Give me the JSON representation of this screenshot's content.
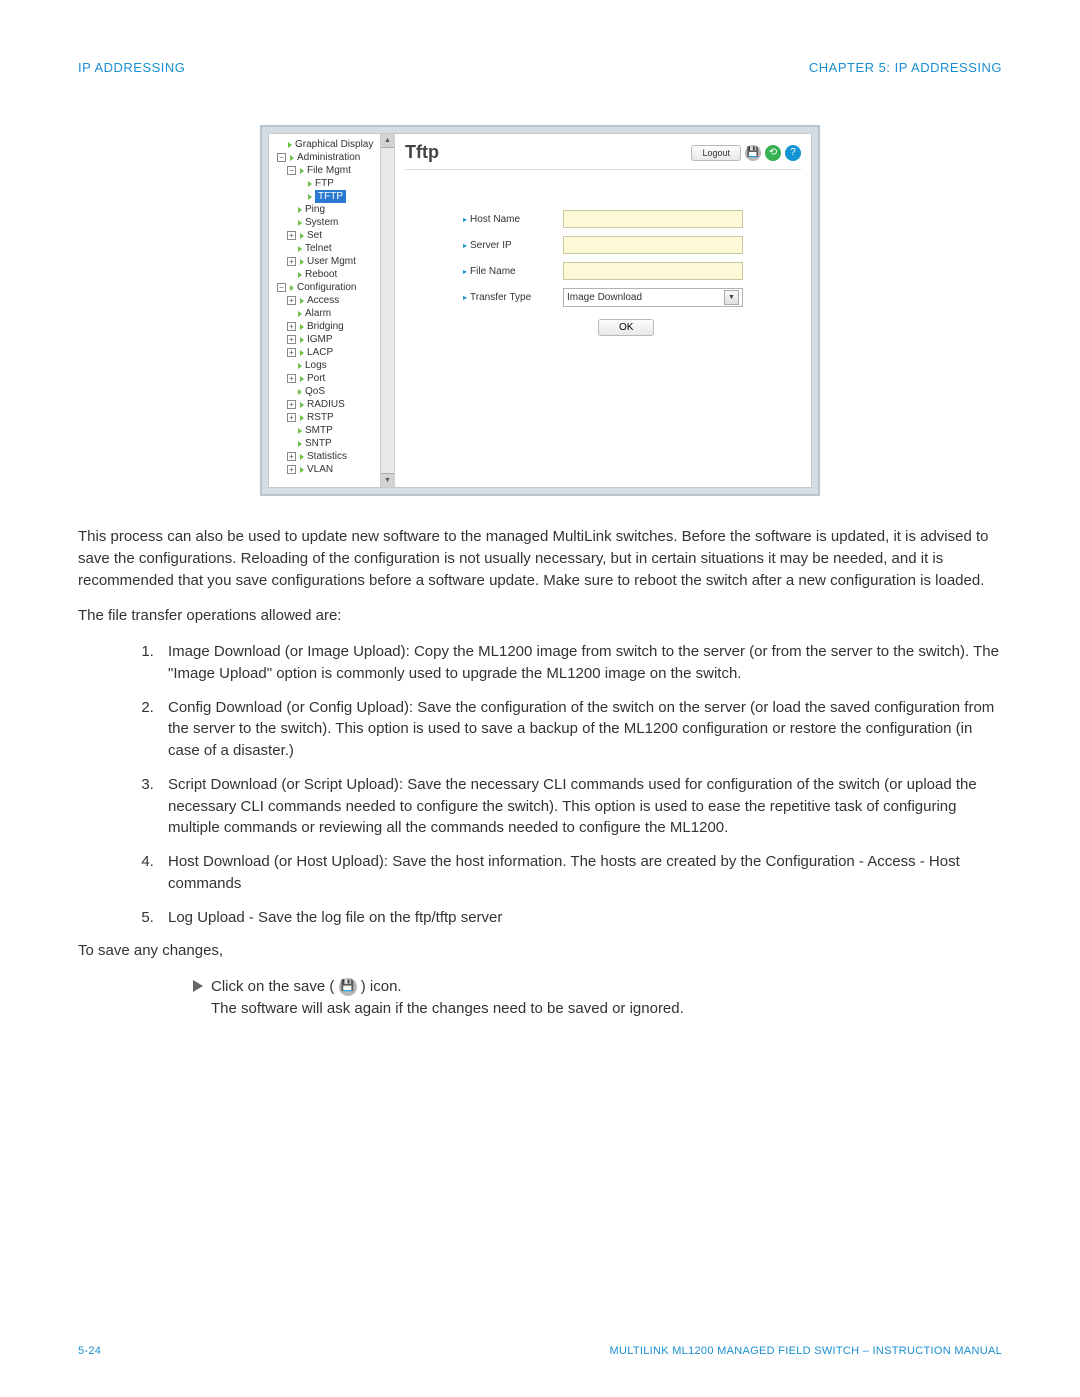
{
  "header": {
    "left": "IP ADDRESSING",
    "right": "CHAPTER 5: IP ADDRESSING"
  },
  "footer": {
    "left": "5-24",
    "right": "MULTILINK ML1200 MANAGED FIELD SWITCH – INSTRUCTION MANUAL"
  },
  "screenshot": {
    "title": "Tftp",
    "logout": "Logout",
    "tree": {
      "graphical": "Graphical Display",
      "admin": "Administration",
      "filemgmt": "File Mgmt",
      "ftp": "FTP",
      "tftp": "TFTP",
      "ping": "Ping",
      "system": "System",
      "set": "Set",
      "telnet": "Telnet",
      "usermgmt": "User Mgmt",
      "reboot": "Reboot",
      "config": "Configuration",
      "access": "Access",
      "alarm": "Alarm",
      "bridging": "Bridging",
      "igmp": "IGMP",
      "lacp": "LACP",
      "logs": "Logs",
      "port": "Port",
      "qos": "QoS",
      "radius": "RADIUS",
      "rstp": "RSTP",
      "smtp": "SMTP",
      "sntp": "SNTP",
      "stats": "Statistics",
      "vlan": "VLAN"
    },
    "form": {
      "hostname_label": "Host Name",
      "serverip_label": "Server IP",
      "filename_label": "File Name",
      "transfertype_label": "Transfer Type",
      "transfertype_value": "Image Download",
      "ok": "OK"
    }
  },
  "body": {
    "p1": "This process can also be used to update new software to the managed MultiLink switches. Before the software is updated, it is advised to save the configurations. Reloading of the configuration is not usually necessary, but in certain situations it may be needed, and it is recommended that you save configurations before a software update. Make sure to reboot the switch after a new configuration is loaded.",
    "p2": "The file transfer operations allowed are:",
    "li1": "Image Download (or Image Upload): Copy the ML1200 image from switch to the server (or from the server to the switch). The \"Image Upload\" option is commonly used to upgrade the ML1200 image on the switch.",
    "li2": "Config Download (or Config Upload): Save the configuration of the switch on the server (or load the saved configuration from the server to the switch). This option is used to save a backup of the ML1200 configuration or restore the configuration (in case of a disaster.)",
    "li3": "Script Download (or Script Upload): Save the necessary CLI commands used for configuration of the switch (or upload the necessary CLI commands needed to configure the switch). This option is used to ease the repetitive task of configuring multiple commands or reviewing all the commands needed to configure the ML1200.",
    "li4": "Host Download (or Host Upload): Save the host information. The hosts are created by the Configuration - Access - Host commands",
    "li5": "Log Upload - Save the log file on the ftp/tftp server",
    "p3": "To save any changes,",
    "instr_a": "Click on the save (",
    "instr_b": ") icon.",
    "instr2": "The software will ask again if the changes need to be saved or ignored."
  }
}
